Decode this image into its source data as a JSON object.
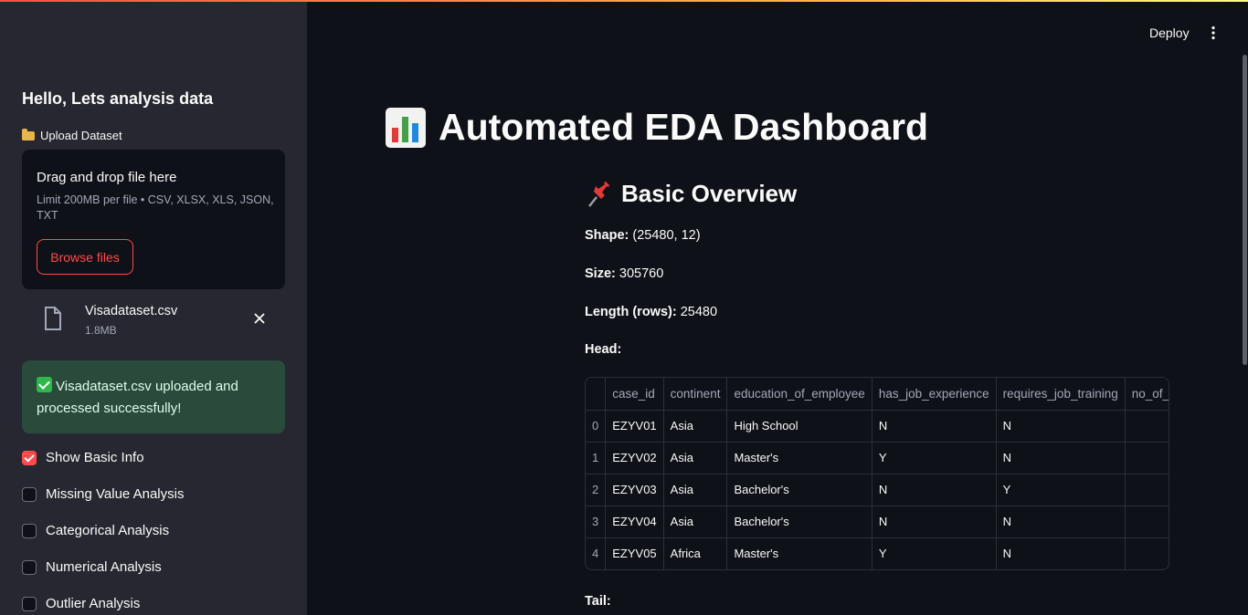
{
  "header": {
    "deploy_label": "Deploy",
    "menu_icon": "kebab-menu-icon",
    "accent_gradient": [
      "#ff4b4b",
      "#ffbd45",
      "#fffd80"
    ]
  },
  "sidebar": {
    "greeting": "Hello, Lets analysis data",
    "upload_label": "Upload Dataset",
    "dropzone": {
      "title": "Drag and drop file here",
      "limit": "Limit 200MB per file • CSV, XLSX, XLS, JSON, TXT",
      "browse_label": "Browse files"
    },
    "uploaded_file": {
      "name": "Visadataset.csv",
      "size": "1.8MB"
    },
    "success_message": "Visadataset.csv uploaded and processed successfully!",
    "options": [
      {
        "label": "Show Basic Info",
        "checked": true
      },
      {
        "label": "Missing Value Analysis",
        "checked": false
      },
      {
        "label": "Categorical Analysis",
        "checked": false
      },
      {
        "label": "Numerical Analysis",
        "checked": false
      },
      {
        "label": "Outlier Analysis",
        "checked": false
      }
    ]
  },
  "main": {
    "title": "Automated EDA Dashboard",
    "section_title": "Basic Overview",
    "shape_label": "Shape:",
    "shape_value": "(25480, 12)",
    "size_label": "Size:",
    "size_value": "305760",
    "length_label": "Length (rows):",
    "length_value": "25480",
    "head_label": "Head:",
    "tail_label": "Tail:",
    "head_table": {
      "columns": [
        "",
        "case_id",
        "continent",
        "education_of_employee",
        "has_job_experience",
        "requires_job_training",
        "no_of_employees"
      ],
      "rows": [
        [
          "0",
          "EZYV01",
          "Asia",
          "High School",
          "N",
          "N",
          ""
        ],
        [
          "1",
          "EZYV02",
          "Asia",
          "Master's",
          "Y",
          "N",
          ""
        ],
        [
          "2",
          "EZYV03",
          "Asia",
          "Bachelor's",
          "N",
          "Y",
          ""
        ],
        [
          "3",
          "EZYV04",
          "Asia",
          "Bachelor's",
          "N",
          "N",
          ""
        ],
        [
          "4",
          "EZYV05",
          "Africa",
          "Master's",
          "Y",
          "N",
          ""
        ]
      ]
    }
  }
}
